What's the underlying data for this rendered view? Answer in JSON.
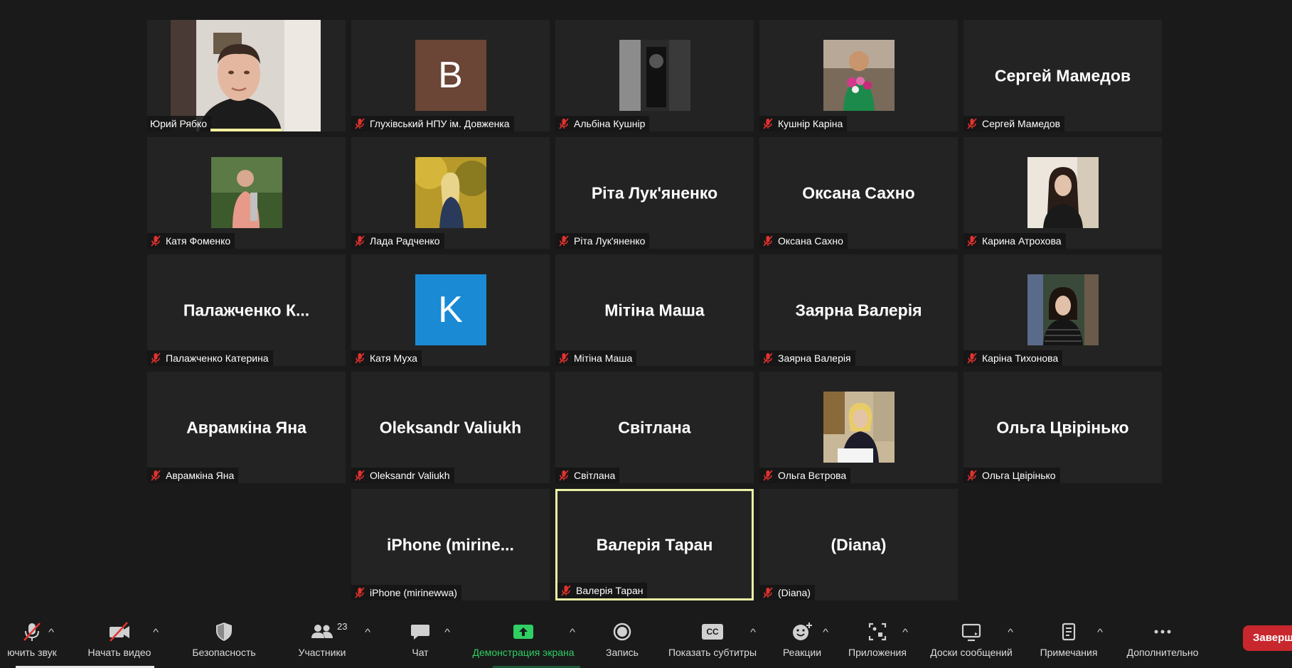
{
  "participants": [
    {
      "big": "",
      "label": "Юрий Рябко",
      "kind": "video",
      "speaking_bar": true
    },
    {
      "big": "",
      "label": "Глухівський НПУ ім. Довженка",
      "kind": "avatar",
      "letter": "B",
      "color": "#6b4535"
    },
    {
      "big": "",
      "label": "Альбіна Кушнір",
      "kind": "photo",
      "photo": "bw"
    },
    {
      "big": "",
      "label": "Кушнір Каріна",
      "kind": "photo",
      "photo": "flowers"
    },
    {
      "big": "Сергей Мамедов",
      "label": "Сергей Мамедов",
      "kind": "name"
    },
    {
      "big": "",
      "label": "Катя Фоменко",
      "kind": "photo",
      "photo": "girl-pink"
    },
    {
      "big": "",
      "label": "Лада Радченко",
      "kind": "photo",
      "photo": "autumn"
    },
    {
      "big": "Ріта Лук'яненко",
      "label": "Ріта Лук'яненко",
      "kind": "name"
    },
    {
      "big": "Оксана Сахно",
      "label": "Оксана Сахно",
      "kind": "name"
    },
    {
      "big": "",
      "label": "Карина Атрохова",
      "kind": "photo",
      "photo": "dark-hair"
    },
    {
      "big": "Палажченко  К...",
      "label": "Палажченко Катерина",
      "kind": "name"
    },
    {
      "big": "",
      "label": "Катя Муха",
      "kind": "avatar",
      "letter": "K",
      "color": "#1a8ad4"
    },
    {
      "big": "Мітіна Маша",
      "label": "Мітіна Маша",
      "kind": "name"
    },
    {
      "big": "Заярна Валерія",
      "label": "Заярна Валерія",
      "kind": "name"
    },
    {
      "big": "",
      "label": "Каріна Тихонова",
      "kind": "photo",
      "photo": "library"
    },
    {
      "big": "Аврамкіна Яна",
      "label": "Аврамкіна Яна",
      "kind": "name"
    },
    {
      "big": "Oleksandr Valiukh",
      "label": "Oleksandr Valiukh",
      "kind": "name"
    },
    {
      "big": "Світлана",
      "label": "Світлана",
      "kind": "name"
    },
    {
      "big": "",
      "label": "Ольга Вєтрова",
      "kind": "photo",
      "photo": "office"
    },
    {
      "big": "Ольга Цвірінько",
      "label": "Ольга Цвірінько",
      "kind": "name"
    },
    {
      "big": "iPhone  (mirine...",
      "label": "iPhone (mirinewwa)",
      "kind": "name"
    },
    {
      "big": "Валерія Таран",
      "label": "Валерія Таран",
      "kind": "name",
      "speaking": true
    },
    {
      "big": "(Diana)",
      "label": " (Diana)",
      "kind": "name"
    }
  ],
  "toolbar": {
    "mute_label": "ючить звук",
    "video_label": "Начать видео",
    "security_label": "Безопасность",
    "participants_label": "Участники",
    "participants_count": "23",
    "chat_label": "Чат",
    "share_label": "Демонстрация экрана",
    "record_label": "Запись",
    "captions_label": "Показать субтитры",
    "captions_icon_text": "CC",
    "reactions_label": "Реакции",
    "apps_label": "Приложения",
    "whiteboards_label": "Доски сообщений",
    "notes_label": "Примечания",
    "more_label": "Дополнительно",
    "end_label": "Заверш"
  },
  "colors": {
    "background": "#1a1a1a",
    "tile": "#232323",
    "speaking_border": "#e9f1a6",
    "share_green": "#2ecf63",
    "end_red": "#c8272d",
    "muted_red": "#e2322e"
  }
}
